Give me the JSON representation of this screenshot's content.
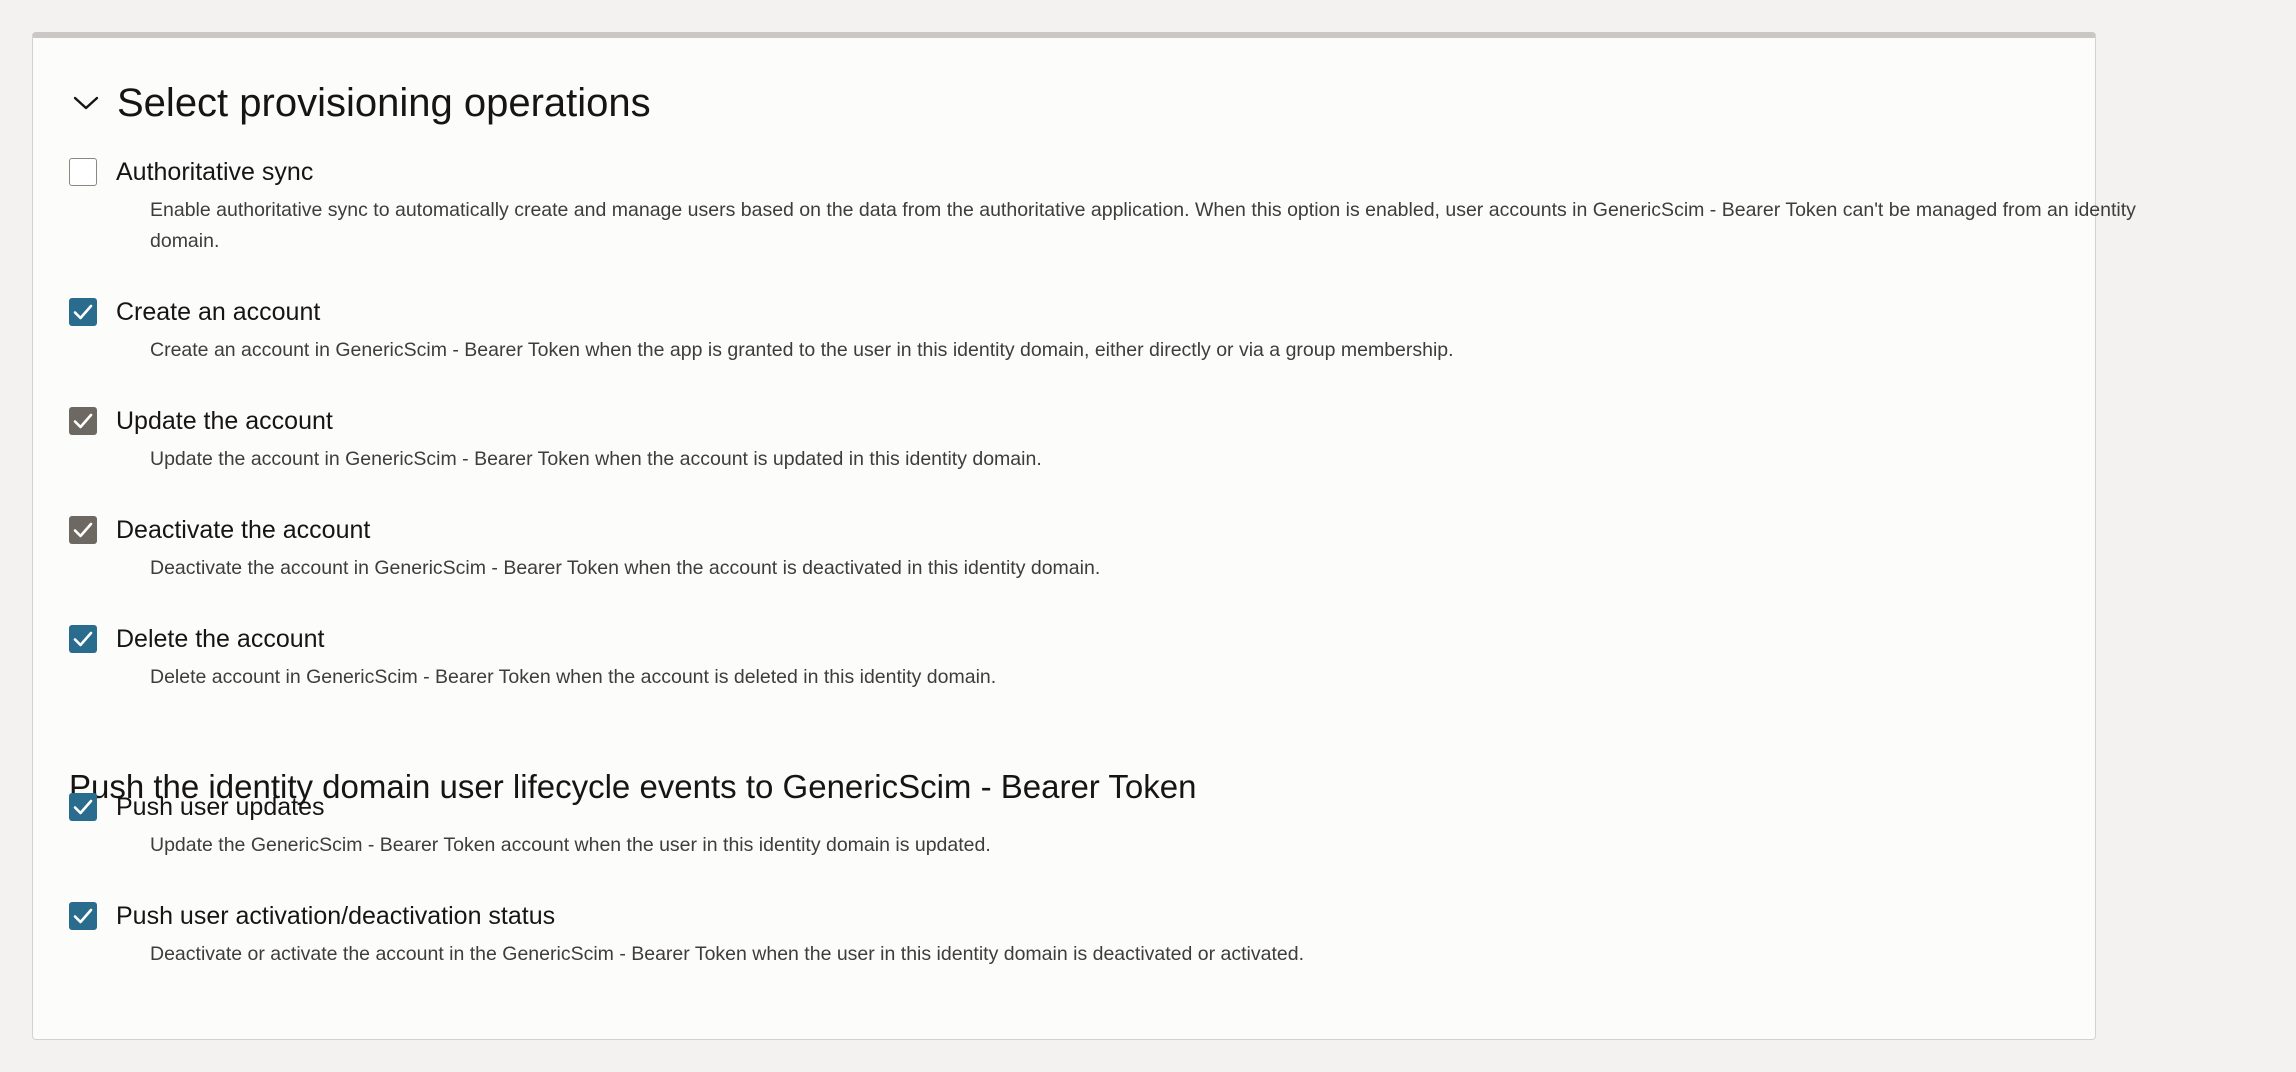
{
  "section": {
    "title": "Select provisioning operations",
    "expanded": true
  },
  "colors": {
    "checkbox_blue": "#2a6c8e",
    "checkbox_gray": "#6e6863",
    "page_bg": "#f3f2f0",
    "panel_bg": "#fcfcfb"
  },
  "operations": [
    {
      "label": "Authoritative sync",
      "description": "Enable authoritative sync to automatically create and manage users based on the data from the authoritative application. When this option is enabled, user accounts in GenericScim - Bearer Token can't be managed from an identity domain.",
      "checked": false
    },
    {
      "label": "Create an account",
      "description": "Create an account in GenericScim - Bearer Token when the app is granted to the user in this identity domain, either directly or via a group membership.",
      "checked": true
    },
    {
      "label": "Update the account",
      "description": "Update the account in GenericScim - Bearer Token when the account is updated in this identity domain.",
      "checked": true
    },
    {
      "label": "Deactivate the account",
      "description": "Deactivate the account in GenericScim - Bearer Token when the account is deactivated in this identity domain.",
      "checked": true
    },
    {
      "label": "Delete the account",
      "description": "Delete account in GenericScim - Bearer Token when the account is deleted in this identity domain.",
      "checked": true
    }
  ],
  "push_section": {
    "heading": "Push the identity domain user lifecycle events to GenericScim - Bearer Token",
    "options": [
      {
        "label": "Push user updates",
        "description": "Update the GenericScim - Bearer Token account when the user in this identity domain is updated.",
        "checked": true
      },
      {
        "label": "Push user activation/deactivation status",
        "description": "Deactivate or activate the account in the GenericScim - Bearer Token when the user in this identity domain is deactivated or activated.",
        "checked": true
      }
    ]
  }
}
